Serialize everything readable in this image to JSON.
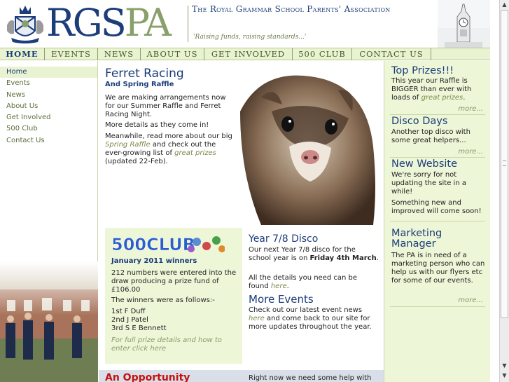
{
  "header": {
    "logo_main": "RGS",
    "logo_accent": "PA",
    "association_name": "The Royal Grammar School Parents' Association",
    "tagline": "'Raising funds, raising standards...'"
  },
  "nav": {
    "tabs": [
      {
        "label": "HOME",
        "active": true
      },
      {
        "label": "EVENTS"
      },
      {
        "label": "NEWS"
      },
      {
        "label": "ABOUT US"
      },
      {
        "label": "GET INVOLVED"
      },
      {
        "label": "500 CLUB"
      },
      {
        "label": "CONTACT US"
      }
    ]
  },
  "sidebar": {
    "items": [
      {
        "label": "Home",
        "active": true
      },
      {
        "label": "Events"
      },
      {
        "label": "News"
      },
      {
        "label": "About Us"
      },
      {
        "label": "Get Involved"
      },
      {
        "label": "500 Club"
      },
      {
        "label": "Contact Us"
      }
    ]
  },
  "main": {
    "ferret": {
      "title": "Ferret Racing",
      "subtitle": "And Spring Raffle",
      "p1": "We are making arrangements now for our Summer Raffle and Ferret Racing Night.",
      "p2": "More details as they come in!",
      "p3_a": "Meanwhile, read more about our big ",
      "p3_link1": "Spring Raffle",
      "p3_b": " and check out the ever-growing list of ",
      "p3_link2": "great prizes",
      "p3_c": " (updated 22-Feb)."
    },
    "club": {
      "logo_text": "500CLUB",
      "heading": "January 2011 winners",
      "p1": "212 numbers were entered into the draw producing a prize fund of £106.00",
      "p2": "The winners were as follows:-",
      "winners": [
        "1st F Duff",
        "2nd J Patel",
        "3rd S E Bennett"
      ],
      "footer_a": "For full prize details and how to enter ",
      "footer_link": "click here"
    },
    "disco": {
      "title": "Year 7/8 Disco",
      "p1_a": "Our next Year 7/8 disco for the school year is on ",
      "p1_bold": "Friday 4th March",
      "p1_b": ".",
      "p2_a": "All the details you need can be found ",
      "p2_link": "here",
      "p2_b": "."
    },
    "events": {
      "title": "More Events",
      "p_a": "Check out our latest event news ",
      "p_link": "here",
      "p_b": " and come back to our site for more updates throughout the year."
    },
    "opportunity": {
      "title": "An Opportunity",
      "text": "Right now we need some help with"
    }
  },
  "right": {
    "prizes": {
      "title": "Top Prizes!!!",
      "text_a": "This year our Raffle is BIGGER than ever with loads of ",
      "text_link": "great prizes",
      "text_b": ".",
      "more": "more..."
    },
    "disco": {
      "title": "Disco Days",
      "text": "Another top disco with some great helpers...",
      "more": "more..."
    },
    "website": {
      "title": "New Website",
      "p1": "We're sorry for not updating the site in a while!",
      "p2": "Something new and improved will come soon!"
    },
    "marketing": {
      "title_line1": "Marketing",
      "title_line2": "Manager",
      "text": "The PA is in need of a marketing person who can help us with our flyers etc for some of our events.",
      "more": "more..."
    }
  },
  "colors": {
    "brand_blue": "#1c3d7a",
    "brand_green": "#8aa06a",
    "panel_green": "#eef6d8",
    "alert_red": "#c81010"
  }
}
